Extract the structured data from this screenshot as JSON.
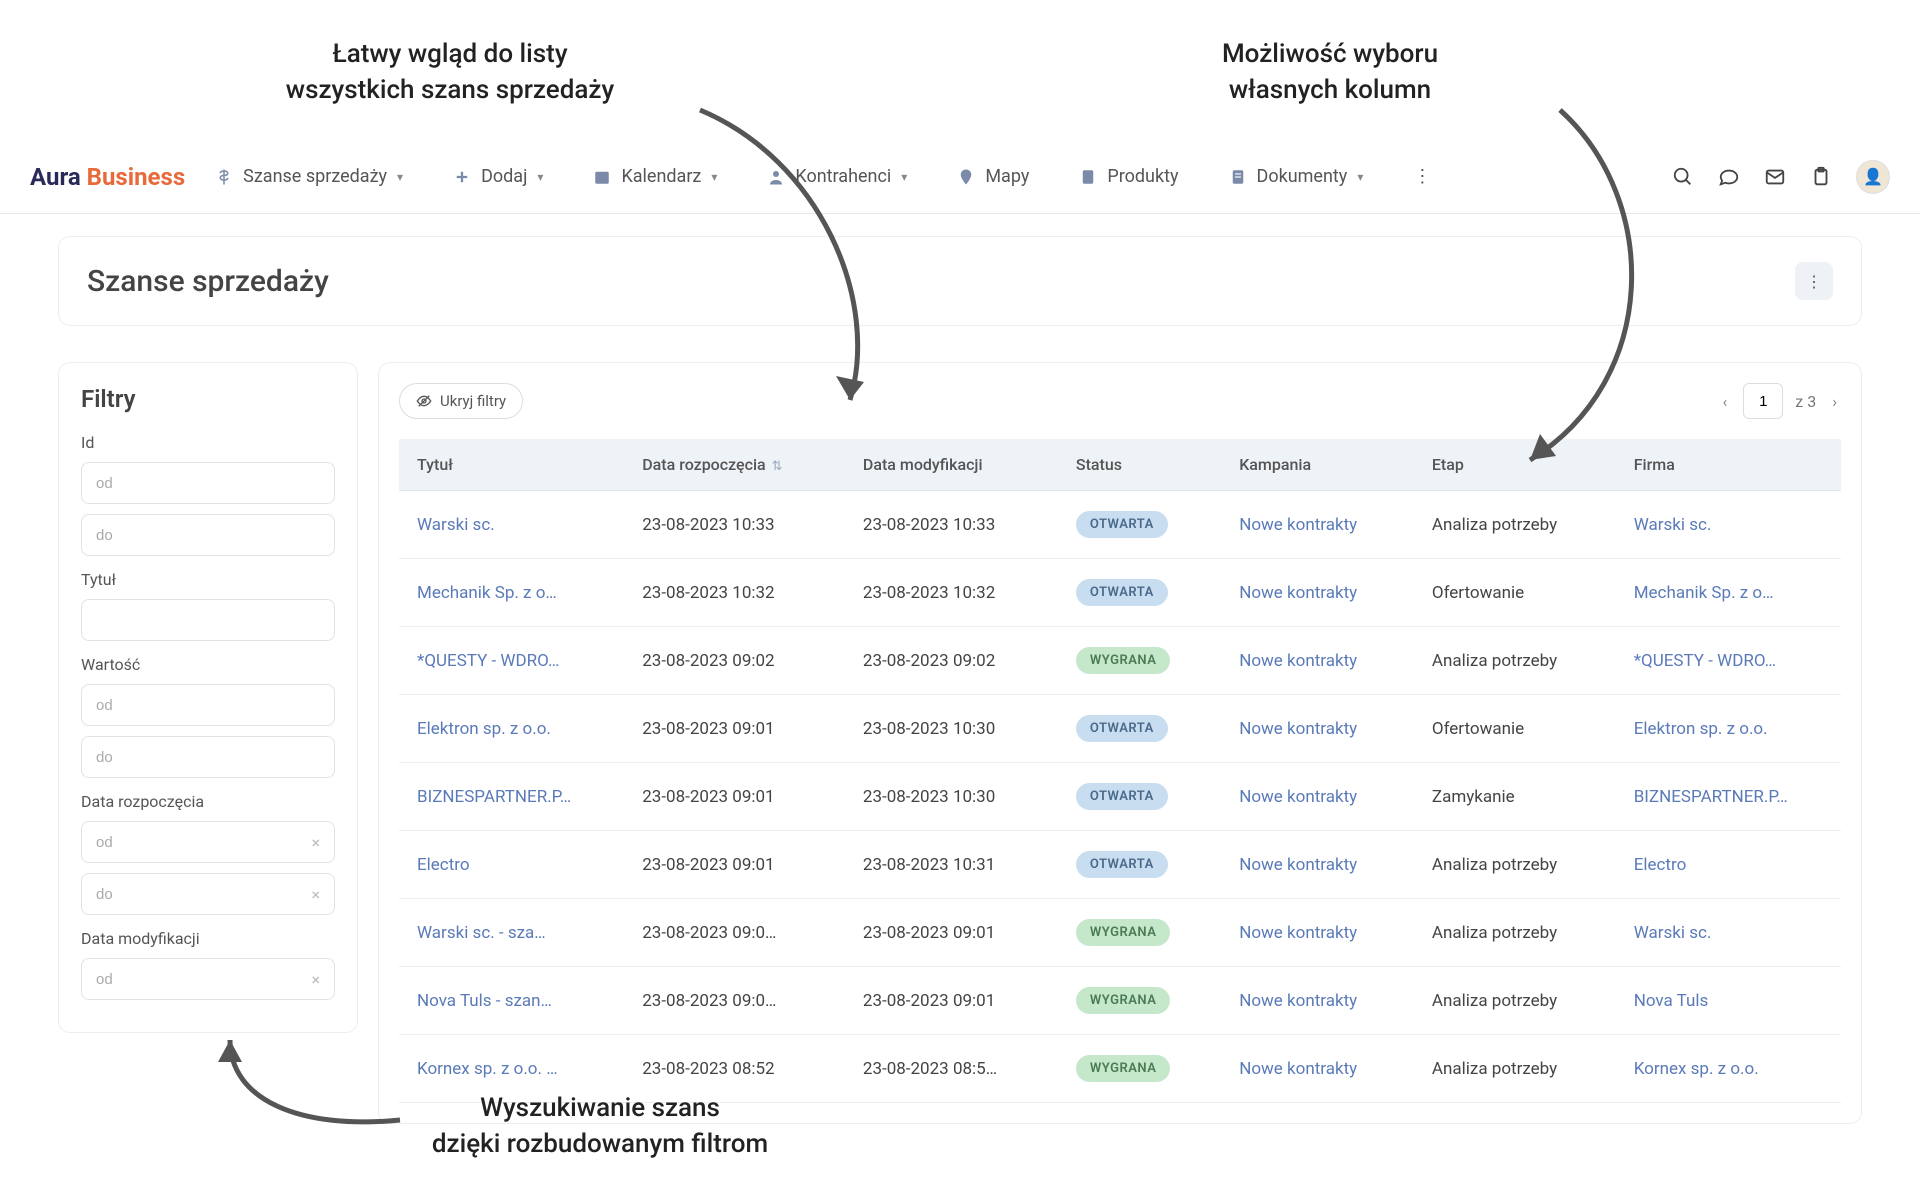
{
  "annotations": {
    "top_left": "Łatwy wgląd do listy\nwszystkich szans sprzedaży",
    "top_right": "Możliwość wyboru\nwłasnych kolumn",
    "bottom": "Wyszukiwanie szans\ndzięki rozbudowanym filtrom"
  },
  "logo": {
    "part1": "Aura",
    "part2": "Business"
  },
  "nav": {
    "szanse": "Szanse sprzedaży",
    "dodaj": "Dodaj",
    "kalendarz": "Kalendarz",
    "kontrahenci": "Kontrahenci",
    "mapy": "Mapy",
    "produkty": "Produkty",
    "dokumenty": "Dokumenty"
  },
  "page": {
    "title": "Szanse sprzedaży"
  },
  "filters": {
    "heading": "Filtry",
    "id_label": "Id",
    "od": "od",
    "do": "do",
    "tytul_label": "Tytuł",
    "wartosc_label": "Wartość",
    "data_rozpoczecia_label": "Data rozpoczęcia",
    "data_modyfikacji_label": "Data modyfikacji"
  },
  "main": {
    "hide_filters": "Ukryj filtry",
    "pager": {
      "current": "1",
      "total_prefix": "z",
      "total": "3"
    },
    "columns": {
      "tytul": "Tytuł",
      "data_rozpoczecia": "Data rozpoczęcia",
      "data_modyfikacji": "Data modyfikacji",
      "status": "Status",
      "kampania": "Kampania",
      "etap": "Etap",
      "firma": "Firma"
    },
    "status_labels": {
      "open": "OTWARTA",
      "won": "WYGRANA"
    },
    "rows": [
      {
        "tytul": "Warski sc.",
        "start": "23-08-2023 10:33",
        "mod": "23-08-2023 10:33",
        "status": "open",
        "kampania": "Nowe kontrakty",
        "etap": "Analiza potrzeby",
        "firma": "Warski sc."
      },
      {
        "tytul": "Mechanik Sp. z o…",
        "start": "23-08-2023 10:32",
        "mod": "23-08-2023 10:32",
        "status": "open",
        "kampania": "Nowe kontrakty",
        "etap": "Ofertowanie",
        "firma": "Mechanik Sp. z o…"
      },
      {
        "tytul": "*QUESTY - WDRO…",
        "start": "23-08-2023 09:02",
        "mod": "23-08-2023 09:02",
        "status": "won",
        "kampania": "Nowe kontrakty",
        "etap": "Analiza potrzeby",
        "firma": "*QUESTY - WDRO…"
      },
      {
        "tytul": "Elektron sp. z o.o.",
        "start": "23-08-2023 09:01",
        "mod": "23-08-2023 10:30",
        "status": "open",
        "kampania": "Nowe kontrakty",
        "etap": "Ofertowanie",
        "firma": "Elektron sp. z o.o."
      },
      {
        "tytul": "BIZNESPARTNER.P…",
        "start": "23-08-2023 09:01",
        "mod": "23-08-2023 10:30",
        "status": "open",
        "kampania": "Nowe kontrakty",
        "etap": "Zamykanie",
        "firma": "BIZNESPARTNER.P…"
      },
      {
        "tytul": "Electro",
        "start": "23-08-2023 09:01",
        "mod": "23-08-2023 10:31",
        "status": "open",
        "kampania": "Nowe kontrakty",
        "etap": "Analiza potrzeby",
        "firma": "Electro"
      },
      {
        "tytul": "Warski sc. - sza…",
        "start": "23-08-2023 09:0…",
        "mod": "23-08-2023 09:01",
        "status": "won",
        "kampania": "Nowe kontrakty",
        "etap": "Analiza potrzeby",
        "firma": "Warski sc."
      },
      {
        "tytul": "Nova Tuls - szan…",
        "start": "23-08-2023 09:0…",
        "mod": "23-08-2023 09:01",
        "status": "won",
        "kampania": "Nowe kontrakty",
        "etap": "Analiza potrzeby",
        "firma": "Nova Tuls"
      },
      {
        "tytul": "Kornex sp. z o.o. …",
        "start": "23-08-2023 08:52",
        "mod": "23-08-2023 08:5…",
        "status": "won",
        "kampania": "Nowe kontrakty",
        "etap": "Analiza potrzeby",
        "firma": "Kornex sp. z o.o."
      }
    ]
  }
}
